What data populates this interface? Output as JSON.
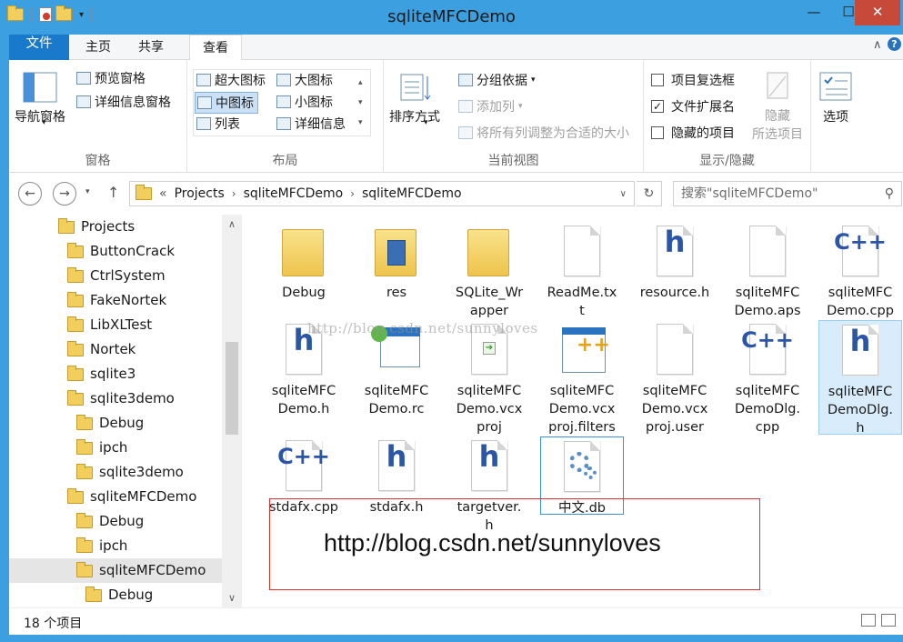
{
  "window": {
    "title": "sqliteMFCDemo",
    "controls": {
      "minimize": "—",
      "maximize": "☐",
      "close": "✕"
    }
  },
  "ribbon_tabs": [
    "文件",
    "主页",
    "共享",
    "查看"
  ],
  "ribbon": {
    "panes": {
      "nav_pane": "导航窗格",
      "preview_pane": "预览窗格",
      "details_pane": "详细信息窗格",
      "label": "窗格"
    },
    "layout": {
      "extra_large": "超大图标",
      "large": "大图标",
      "medium": "中图标",
      "small": "小图标",
      "list": "列表",
      "details": "详细信息",
      "label": "布局"
    },
    "current_view": {
      "sort_by": "排序方式",
      "group_by": "分组依据",
      "add_column": "添加列",
      "fit_columns": "将所有列调整为合适的大小",
      "label": "当前视图"
    },
    "show_hide": {
      "item_checkboxes": "项目复选框",
      "file_extensions": "文件扩展名",
      "hidden_items": "隐藏的项目",
      "hide_selected": "隐藏\n所选项目",
      "label": "显示/隐藏"
    },
    "options": "选项"
  },
  "address": {
    "breadcrumb": [
      "Projects",
      "sqliteMFCDemo",
      "sqliteMFCDemo"
    ],
    "overflow": "«",
    "search_placeholder": "搜索\"sqliteMFCDemo\""
  },
  "tree": [
    {
      "label": "Projects",
      "level": 0
    },
    {
      "label": "ButtonCrack",
      "level": 1
    },
    {
      "label": "CtrlSystem",
      "level": 1
    },
    {
      "label": "FakeNortek",
      "level": 1
    },
    {
      "label": "LibXLTest",
      "level": 1
    },
    {
      "label": "Nortek",
      "level": 1
    },
    {
      "label": "sqlite3",
      "level": 1
    },
    {
      "label": "sqlite3demo",
      "level": 1
    },
    {
      "label": "Debug",
      "level": 2
    },
    {
      "label": "ipch",
      "level": 2
    },
    {
      "label": "sqlite3demo",
      "level": 2
    },
    {
      "label": "sqliteMFCDemo",
      "level": 1
    },
    {
      "label": "Debug",
      "level": 2
    },
    {
      "label": "ipch",
      "level": 2
    },
    {
      "label": "sqliteMFCDemo",
      "level": 2,
      "selected": true
    },
    {
      "label": "Debug",
      "level": 3
    }
  ],
  "files": [
    {
      "name": "Debug",
      "icon": "folder-icon"
    },
    {
      "name": "res",
      "icon": "folder-icon"
    },
    {
      "name": "SQLite_Wrapper",
      "icon": "folder-icon"
    },
    {
      "name": "ReadMe.txt",
      "icon": "text-file-icon"
    },
    {
      "name": "resource.h",
      "icon": "header-file-icon"
    },
    {
      "name": "sqliteMFCDemo.aps",
      "icon": "blank-file-icon"
    },
    {
      "name": "sqliteMFCDemo.cpp",
      "icon": "cpp-file-icon"
    },
    {
      "name": "sqliteMFCDemo.h",
      "icon": "header-file-icon"
    },
    {
      "name": "sqliteMFCDemo.rc",
      "icon": "resource-file-icon"
    },
    {
      "name": "sqliteMFCDemo.vcxproj",
      "icon": "vcxproj-file-icon"
    },
    {
      "name": "sqliteMFCDemo.vcxproj.filters",
      "icon": "filters-file-icon"
    },
    {
      "name": "sqliteMFCDemo.vcxproj.user",
      "icon": "blank-file-icon"
    },
    {
      "name": "sqliteMFCDemoDlg.cpp",
      "icon": "cpp-file-icon"
    },
    {
      "name": "sqliteMFCDemoDlg.h",
      "icon": "header-file-icon"
    },
    {
      "name": "stdafx.cpp",
      "icon": "cpp-file-icon"
    },
    {
      "name": "stdafx.h",
      "icon": "header-file-icon"
    },
    {
      "name": "targetver.h",
      "icon": "header-file-icon"
    },
    {
      "name": "中文.db",
      "icon": "db-file-icon"
    }
  ],
  "labels": {
    "debug": "Debug",
    "res": "res",
    "sqlite_wrapper_1": "SQLite_Wr",
    "sqlite_wrapper_2": "apper",
    "readme_1": "ReadMe.tx",
    "readme_2": "t",
    "resource_h": "resource.h",
    "aps_1": "sqliteMFC",
    "aps_2": "Demo.aps",
    "cpp_1": "sqliteMFC",
    "cpp_2": "Demo.cpp",
    "h_1": "sqliteMFC",
    "h_2": "Demo.h",
    "rc_1": "sqliteMFC",
    "rc_2": "Demo.rc",
    "vcx_1": "sqliteMFC",
    "vcx_2": "Demo.vcx",
    "vcx_3": "proj",
    "flt_1": "sqliteMFC",
    "flt_2": "Demo.vcx",
    "flt_3": "proj.filters",
    "usr_1": "sqliteMFC",
    "usr_2": "Demo.vcx",
    "usr_3": "proj.user",
    "dlgcpp_1": "sqliteMFC",
    "dlgcpp_2": "DemoDlg.",
    "dlgcpp_3": "cpp",
    "dlgh_1": "sqliteMFC",
    "dlgh_2": "DemoDlg.",
    "dlgh_3": "h",
    "stdafx_cpp": "stdafx.cpp",
    "stdafx_h": "stdafx.h",
    "targetver_1": "targetver.",
    "targetver_2": "h",
    "db": "中文.db"
  },
  "watermark": "http://blog.csdn.net/sunnyloves",
  "overlay_url": "http://blog.csdn.net/sunnyloves",
  "status": {
    "count": "18 个项目"
  },
  "colors": {
    "title_bar": "#3ca0e0",
    "file_tab": "#1979ca",
    "selection": "#d9ecfb",
    "annotation_box": "#e03030"
  }
}
